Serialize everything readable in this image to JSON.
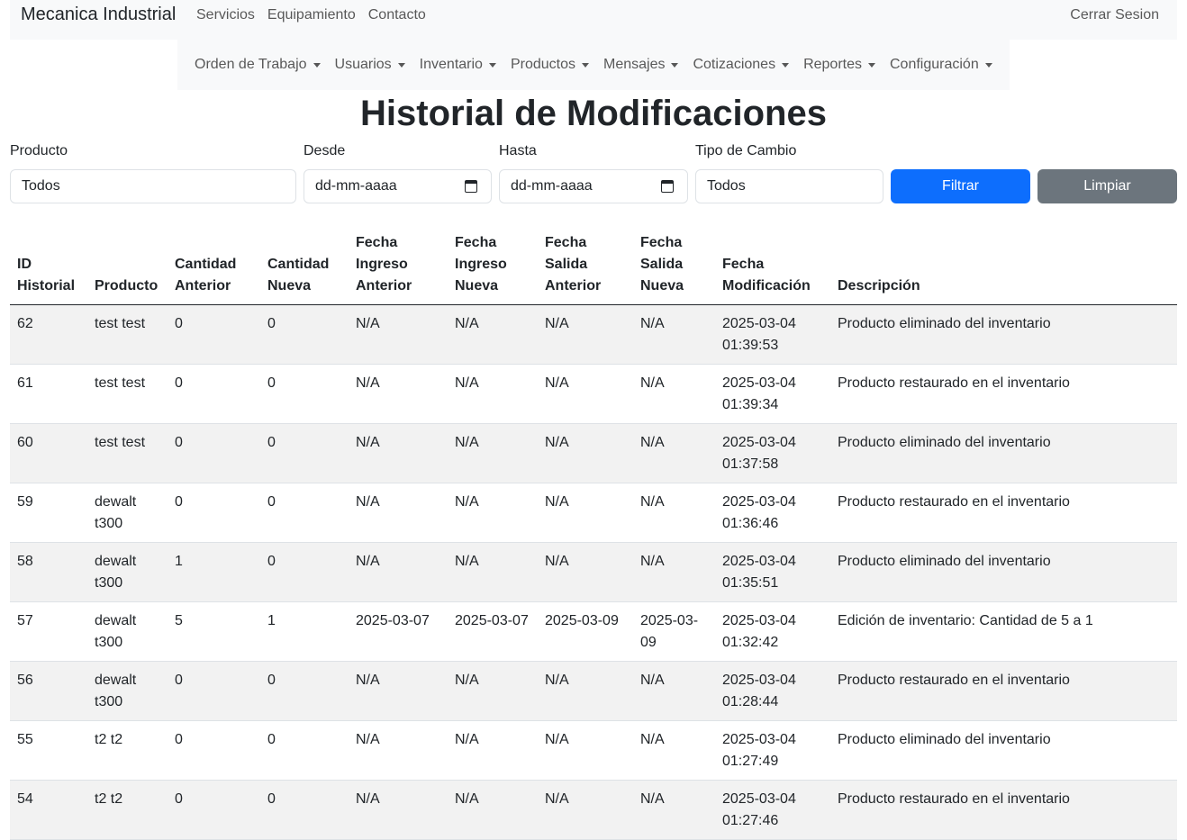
{
  "nav": {
    "brand": "Mecanica Industrial",
    "links": [
      "Servicios",
      "Equipamiento",
      "Contacto"
    ],
    "logout": "Cerrar Sesion"
  },
  "subnav": [
    "Orden de Trabajo",
    "Usuarios",
    "Inventario",
    "Productos",
    "Mensajes",
    "Cotizaciones",
    "Reportes",
    "Configuración"
  ],
  "page_title": "Historial de Modificaciones",
  "filters": {
    "producto": {
      "label": "Producto",
      "value": "Todos"
    },
    "desde": {
      "label": "Desde",
      "value": "dd-mm-aaaa"
    },
    "hasta": {
      "label": "Hasta",
      "value": "dd-mm-aaaa"
    },
    "tipo": {
      "label": "Tipo de Cambio",
      "value": "Todos"
    },
    "filter_button": "Filtrar",
    "clear_button": "Limpiar"
  },
  "table": {
    "headers": [
      [
        "ID",
        "Historial"
      ],
      [
        "Producto"
      ],
      [
        "Cantidad",
        "Anterior"
      ],
      [
        "Cantidad",
        "Nueva"
      ],
      [
        "Fecha",
        "Ingreso",
        "Anterior"
      ],
      [
        "Fecha",
        "Ingreso",
        "Nueva"
      ],
      [
        "Fecha",
        "Salida",
        "Anterior"
      ],
      [
        "Fecha",
        "Salida",
        "Nueva"
      ],
      [
        "Fecha",
        "Modificación"
      ],
      [
        "Descripción"
      ]
    ],
    "rows": [
      [
        "62",
        "test test",
        "0",
        "0",
        "N/A",
        "N/A",
        "N/A",
        "N/A",
        "2025-03-04 01:39:53",
        "Producto eliminado del inventario"
      ],
      [
        "61",
        "test test",
        "0",
        "0",
        "N/A",
        "N/A",
        "N/A",
        "N/A",
        "2025-03-04 01:39:34",
        "Producto restaurado en el inventario"
      ],
      [
        "60",
        "test test",
        "0",
        "0",
        "N/A",
        "N/A",
        "N/A",
        "N/A",
        "2025-03-04 01:37:58",
        "Producto eliminado del inventario"
      ],
      [
        "59",
        "dewalt t300",
        "0",
        "0",
        "N/A",
        "N/A",
        "N/A",
        "N/A",
        "2025-03-04 01:36:46",
        "Producto restaurado en el inventario"
      ],
      [
        "58",
        "dewalt t300",
        "1",
        "0",
        "N/A",
        "N/A",
        "N/A",
        "N/A",
        "2025-03-04 01:35:51",
        "Producto eliminado del inventario"
      ],
      [
        "57",
        "dewalt t300",
        "5",
        "1",
        "2025-03-07",
        "2025-03-07",
        "2025-03-09",
        "2025-03-09",
        "2025-03-04 01:32:42",
        "Edición de inventario: Cantidad de 5 a 1"
      ],
      [
        "56",
        "dewalt t300",
        "0",
        "0",
        "N/A",
        "N/A",
        "N/A",
        "N/A",
        "2025-03-04 01:28:44",
        "Producto restaurado en el inventario"
      ],
      [
        "55",
        "t2 t2",
        "0",
        "0",
        "N/A",
        "N/A",
        "N/A",
        "N/A",
        "2025-03-04 01:27:49",
        "Producto eliminado del inventario"
      ],
      [
        "54",
        "t2 t2",
        "0",
        "0",
        "N/A",
        "N/A",
        "N/A",
        "N/A",
        "2025-03-04 01:27:46",
        "Producto restaurado en el inventario"
      ]
    ]
  },
  "colors": {
    "primary": "#0d6efd",
    "secondary": "#6c757d",
    "nav_bg": "#f8f9fa"
  }
}
